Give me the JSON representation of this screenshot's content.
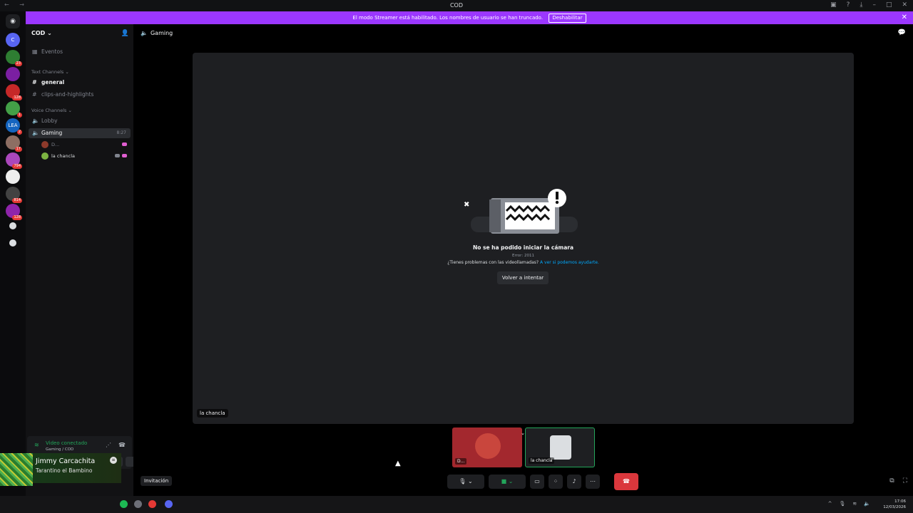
{
  "window": {
    "title": "COD"
  },
  "banner": {
    "text": "El modo Streamer está habilitado. Los nombres de usuario se han truncado.",
    "button": "Deshabilitar",
    "color": "#9b37ff"
  },
  "guilds": [
    {
      "letter": "C",
      "color": "#5865f2",
      "badge": ""
    },
    {
      "letter": "",
      "color": "#2e7d32",
      "badge": "23"
    },
    {
      "letter": "",
      "color": "#7b1fa2",
      "badge": ""
    },
    {
      "letter": "",
      "color": "#c62828",
      "badge": "128"
    },
    {
      "letter": "",
      "color": "#43a047",
      "badge": "1"
    },
    {
      "letter": "LEA",
      "color": "#1565c0",
      "badge": "2"
    },
    {
      "letter": "",
      "color": "#8d6e63",
      "badge": "17"
    },
    {
      "letter": "",
      "color": "#ab47bc",
      "badge": "794"
    },
    {
      "letter": "",
      "color": "#eeeeee",
      "badge": ""
    },
    {
      "letter": "",
      "color": "#424242",
      "badge": "814"
    },
    {
      "letter": "",
      "color": "#8e24aa",
      "badge": "128"
    }
  ],
  "server": {
    "name": "COD",
    "events": "Eventos",
    "text_category": "Text Channels",
    "text_channels": [
      "general",
      "clips-and-highlights"
    ],
    "voice_category": "Voice Channels",
    "voice_channels": [
      "Lobby",
      "Gaming"
    ],
    "gaming_timer": "8:27",
    "voice_users": [
      "D...",
      "la chancla"
    ]
  },
  "voice_status": {
    "title": "Video conectado",
    "subtitle": "Gaming / COD"
  },
  "user_panel": {
    "name": "Jimmy Carcachita",
    "song": "Tarantino el Bambino"
  },
  "main": {
    "channel": "Gaming",
    "error_title": "No se ha podido iniciar la cámara",
    "error_code": "Error: 2011",
    "help_text": "¿Tienes problemas con las videollamadas?",
    "help_link": "A ver si podemos ayudarte.",
    "retry": "Volver a intentar",
    "stage_label": "la chancla",
    "tiles": [
      "D...",
      "la chancla"
    ],
    "invite": "Invitación"
  },
  "taskbar": {
    "time": "17:06",
    "date": "12/03/2026"
  }
}
